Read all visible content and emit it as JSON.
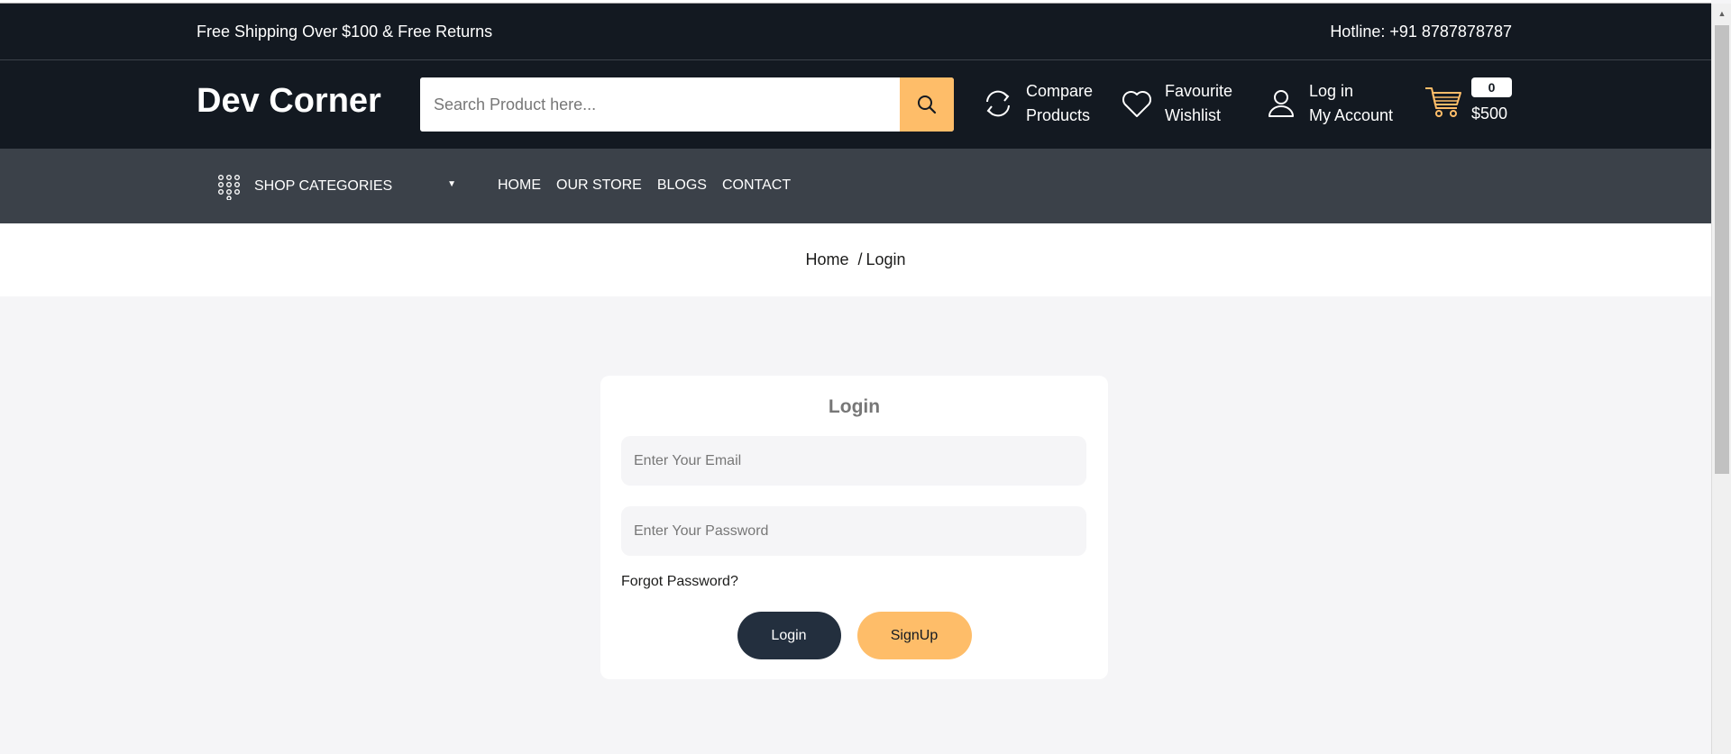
{
  "topbar": {
    "shipping_text": "Free Shipping Over $100 & Free Returns",
    "hotline_text": "Hotline: +91 8787878787"
  },
  "header": {
    "logo": "Dev Corner",
    "search_placeholder": "Search Product here...",
    "compare": {
      "line1": "Compare",
      "line2": "Products"
    },
    "wishlist": {
      "line1": "Favourite",
      "line2": "Wishlist"
    },
    "account": {
      "line1": "Log in",
      "line2": "My Account"
    },
    "cart": {
      "count": "0",
      "total": "$500"
    }
  },
  "nav": {
    "categories_label": "SHOP CATEGORIES",
    "links": [
      "HOME",
      "OUR STORE",
      "BLOGS",
      "CONTACT"
    ]
  },
  "breadcrumb": {
    "home": "Home",
    "separator": "/",
    "current": "Login"
  },
  "login_form": {
    "title": "Login",
    "email_placeholder": "Enter Your Email",
    "password_placeholder": "Enter Your Password",
    "forgot_link": "Forgot Password?",
    "login_button": "Login",
    "signup_button": "SignUp"
  },
  "colors": {
    "header_bg": "#131921",
    "nav_bg": "#3b4149",
    "accent": "#febd69",
    "login_button_bg": "#232f3e",
    "page_bg": "#f5f5f7"
  },
  "icons": [
    "search-icon",
    "compare-icon",
    "heart-icon",
    "user-icon",
    "cart-icon",
    "grid-menu-icon",
    "caret-down-icon"
  ]
}
